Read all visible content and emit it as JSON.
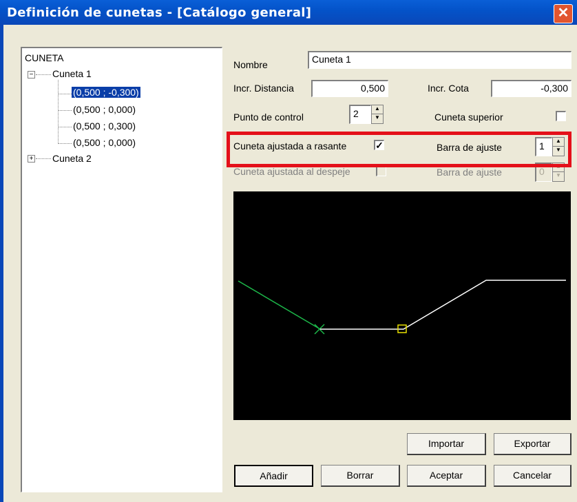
{
  "window": {
    "title": "Definición de cunetas - [Catálogo general]",
    "close_glyph": "✕"
  },
  "tree": {
    "root": "CUNETA",
    "nodes": [
      {
        "label": "Cuneta 1",
        "expanded": true,
        "toggle": "−",
        "children": [
          "(0,500 ; -0,300)",
          "(0,500 ; 0,000)",
          "(0,500 ; 0,300)",
          "(0,500 ; 0,000)"
        ],
        "selected_child": 0
      },
      {
        "label": "Cuneta 2",
        "expanded": false,
        "toggle": "+"
      }
    ]
  },
  "form": {
    "nombre_label": "Nombre",
    "nombre_value": "Cuneta 1",
    "incr_distancia_label": "Incr. Distancia",
    "incr_distancia_value": "0,500",
    "incr_cota_label": "Incr. Cota",
    "incr_cota_value": "-0,300",
    "punto_control_label": "Punto de control",
    "punto_control_value": "2",
    "cuneta_superior_label": "Cuneta superior",
    "cuneta_superior_checked": false,
    "ajustada_rasante_label": "Cuneta ajustada a rasante",
    "ajustada_rasante_checked": true,
    "check_glyph": "✓",
    "barra_ajuste_1_label": "Barra de ajuste",
    "barra_ajuste_1_value": "1",
    "ajustada_despeje_label": "Cuneta ajustada al despeje",
    "ajustada_despeje_checked": false,
    "barra_ajuste_2_label": "Barra de ajuste",
    "barra_ajuste_2_value": "0",
    "spin_up": "▲",
    "spin_down": "▼"
  },
  "buttons": {
    "importar": "Importar",
    "exportar": "Exportar",
    "anadir": "Añadir",
    "borrar": "Borrar",
    "aceptar": "Aceptar",
    "cancelar": "Cancelar"
  },
  "colors": {
    "titlebar": "#0453c9",
    "highlight": "#e4101a",
    "profile_green": "#1db84a",
    "profile_white": "#ffffff",
    "marker_yellow": "#e8e000"
  }
}
